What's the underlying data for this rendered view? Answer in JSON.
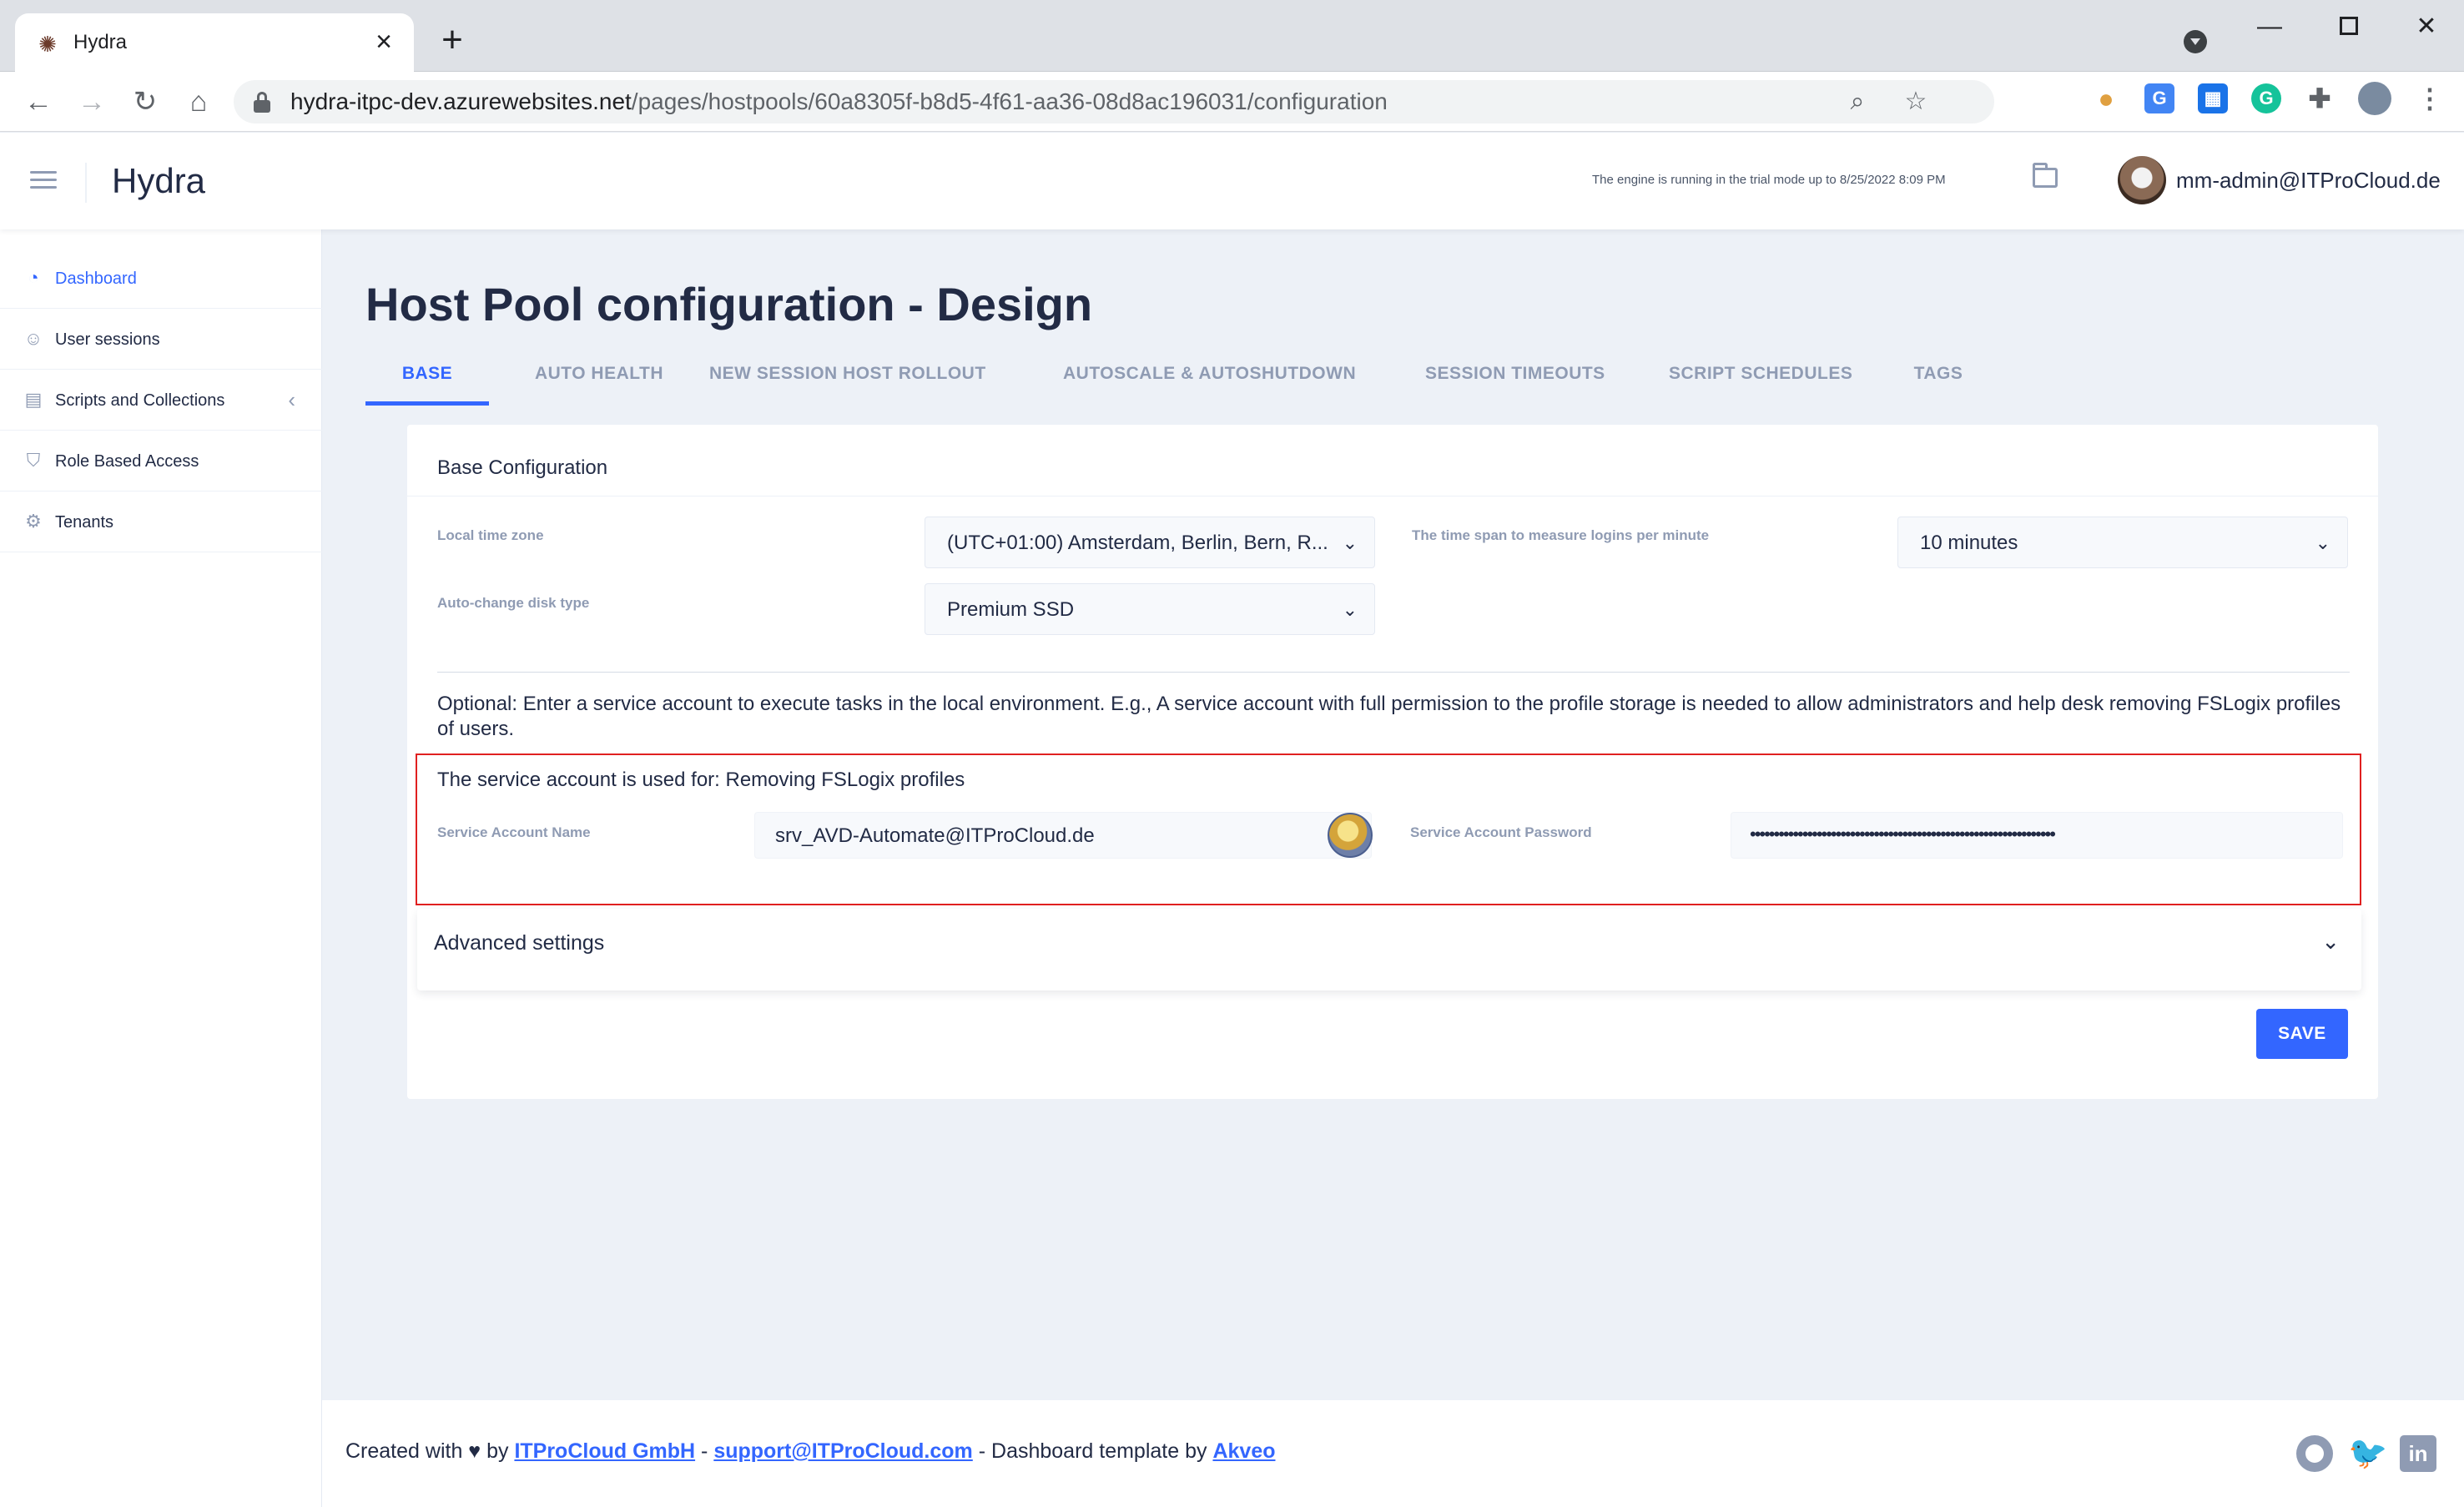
{
  "browser": {
    "tab_title": "Hydra",
    "url_host": "hydra-itpc-dev.azurewebsites.net",
    "url_path": "/pages/hostpools/60a8305f-b8d5-4f61-aa36-08d8ac196031/configuration"
  },
  "header": {
    "brand": "Hydra",
    "trial_notice": "The engine is running in the trial mode up to 8/25/2022 8:09 PM",
    "user": "mm-admin@ITProCloud.de"
  },
  "sidebar": {
    "items": [
      {
        "label": "Dashboard",
        "icon": "pie-chart-icon",
        "active": true
      },
      {
        "label": "User sessions",
        "icon": "people-icon"
      },
      {
        "label": "Scripts and Collections",
        "icon": "archive-icon"
      },
      {
        "label": "Role Based Access",
        "icon": "shield-icon"
      },
      {
        "label": "Tenants",
        "icon": "gear-icon"
      }
    ]
  },
  "page": {
    "title": "Host Pool configuration - Design",
    "tabs": [
      "BASE",
      "AUTO HEALTH",
      "NEW SESSION HOST ROLLOUT",
      "AUTOSCALE & AUTOSHUTDOWN",
      "SESSION TIMEOUTS",
      "SCRIPT SCHEDULES",
      "TAGS"
    ],
    "active_tab": "BASE"
  },
  "base_config": {
    "card_title": "Base Configuration",
    "timezone_label": "Local time zone",
    "timezone_value": "(UTC+01:00) Amsterdam, Berlin, Bern, R...",
    "timespan_label": "The time span to measure logins per minute",
    "timespan_value": "10 minutes",
    "disk_label": "Auto-change disk type",
    "disk_value": "Premium SSD",
    "info_text": "Optional: Enter a service account to execute tasks in the local environment. E.g., A service account with full permission to the profile storage is needed to allow administrators and help desk removing FSLogix profiles of users.",
    "service_usage": "The service account is used for: Removing FSLogix profiles",
    "account_name_label": "Service Account Name",
    "account_name_value": "srv_AVD-Automate@ITProCloud.de",
    "account_password_label": "Service Account Password",
    "account_password_value": "••••••••••••••••••••••••••••••••••••••••••••••••••••••••••••••••",
    "advanced_label": "Advanced settings",
    "save_label": "SAVE"
  },
  "footer": {
    "prefix": "Created with ♥ by ",
    "company": "ITProCloud GmbH",
    "sep1": " - ",
    "email": "support@ITProCloud.com",
    "sep2": " - Dashboard template by ",
    "template": "Akveo"
  },
  "colors": {
    "accent": "#3366ff",
    "highlight_border": "#e02020",
    "muted": "#8f9bb3"
  }
}
